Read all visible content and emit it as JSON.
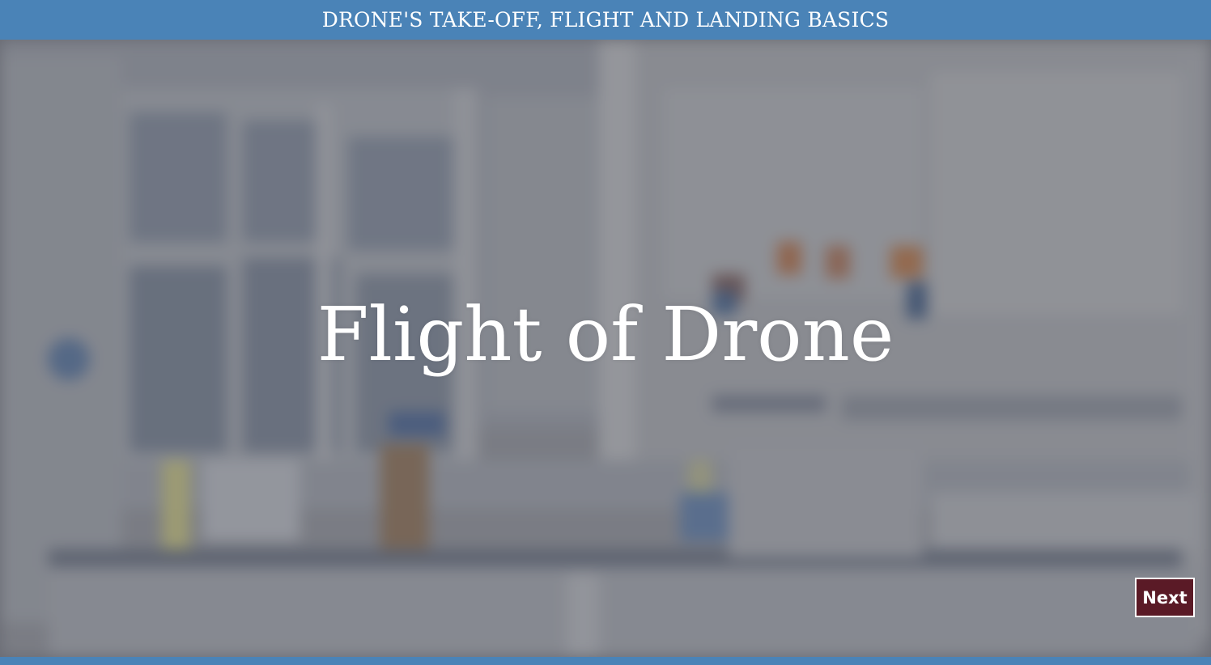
{
  "header": {
    "title": "DRONE'S TAKE-OFF, FLIGHT AND LANDING BASICS"
  },
  "slide": {
    "title": "Flight of Drone"
  },
  "navigation": {
    "next_label": "Next"
  },
  "colors": {
    "header_bar": "#4a83b7",
    "next_button": "#5a1a26",
    "text": "#ffffff"
  }
}
